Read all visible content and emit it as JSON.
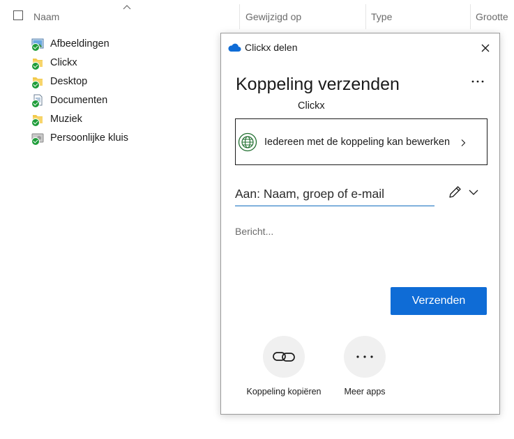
{
  "explorer": {
    "columns": [
      {
        "label": "Naam"
      },
      {
        "label": "Gewijzigd op"
      },
      {
        "label": "Type"
      },
      {
        "label": "Grootte"
      }
    ],
    "files": [
      {
        "name": "Afbeeldingen",
        "icon": "pictures-folder-icon"
      },
      {
        "name": "Clickx",
        "icon": "folder-icon"
      },
      {
        "name": "Desktop",
        "icon": "folder-icon"
      },
      {
        "name": "Documenten",
        "icon": "documents-folder-icon"
      },
      {
        "name": "Muziek",
        "icon": "folder-icon"
      },
      {
        "name": "Persoonlijke kluis",
        "icon": "vault-icon"
      }
    ],
    "status_color": "#1f9d3a"
  },
  "dialog": {
    "title": "Clickx delen",
    "heading": "Koppeling verzenden",
    "item_name": "Clickx",
    "permission_text": "Iedereen met de koppeling kan bewerken",
    "to_placeholder": "Aan: Naam, groep of e-mail",
    "message_placeholder": "Bericht...",
    "send_label": "Verzenden",
    "copy_link_label": "Koppeling kopiëren",
    "more_apps_label": "Meer apps",
    "accent_color": "#0f6cd6",
    "icons": {
      "app": "onedrive-cloud-icon",
      "close": "close-icon",
      "more": "more-options-icon",
      "permission": "globe-icon",
      "edit": "pencil-icon",
      "expand": "chevron-down-icon",
      "copy": "link-icon",
      "apps": "more-horizontal-icon"
    }
  }
}
